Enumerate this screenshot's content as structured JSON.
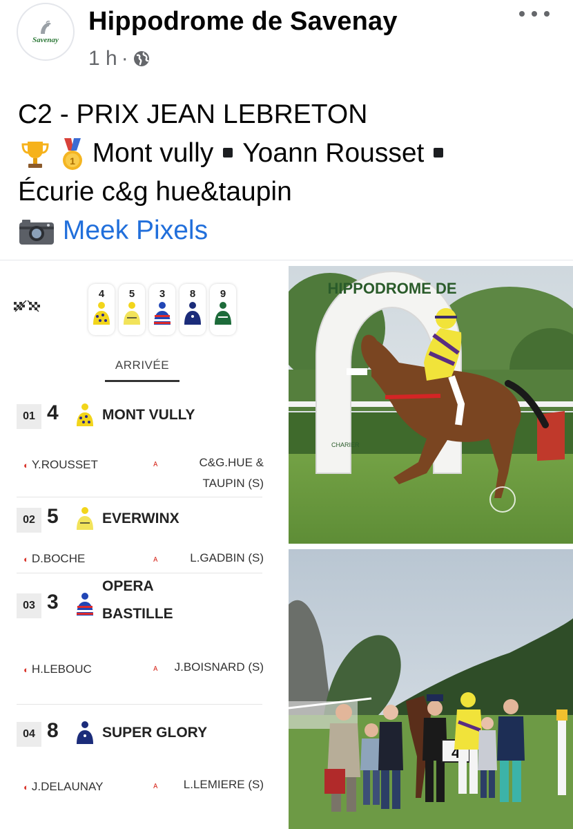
{
  "page": {
    "logo_text": "Savenay",
    "name": "Hippodrome de Savenay",
    "time": "1 h",
    "separator": "·"
  },
  "post": {
    "line1": "C2 - PRIX JEAN LEBRETON",
    "winner": "Mont vully",
    "jockey": "Yoann Rousset",
    "owner": "Écurie c&g hue&taupin",
    "photo_credit": "Meek Pixels"
  },
  "results": {
    "top_numbers": [
      "4",
      "5",
      "3",
      "8",
      "9"
    ],
    "arrivee": "ARRIVÉE",
    "runners": [
      {
        "pos": "01",
        "num": "4",
        "name": "MONT VULLY",
        "jockey": "Y.ROUSSET",
        "trainer": "C&G.HUE & TAUPIN (S)"
      },
      {
        "pos": "02",
        "num": "5",
        "name": "EVERWINX",
        "jockey": "D.BOCHE",
        "trainer": "L.GADBIN (S)"
      },
      {
        "pos": "03",
        "num": "3",
        "name": "OPERA BASTILLE",
        "jockey": "H.LEBOUC",
        "trainer": "J.BOISNARD (S)"
      },
      {
        "pos": "04",
        "num": "8",
        "name": "SUPER GLORY",
        "jockey": "J.DELAUNAY",
        "trainer": "L.LEMIERE (S)"
      }
    ]
  },
  "photos": {
    "arch_text": "HIPPODROME DE",
    "sponsor_text": "CHARIER",
    "bib_number": "4"
  },
  "colors": {
    "accent_link": "#216fdb",
    "meta_gray": "#65676b",
    "jockey_icon_red": "#d9352b"
  }
}
